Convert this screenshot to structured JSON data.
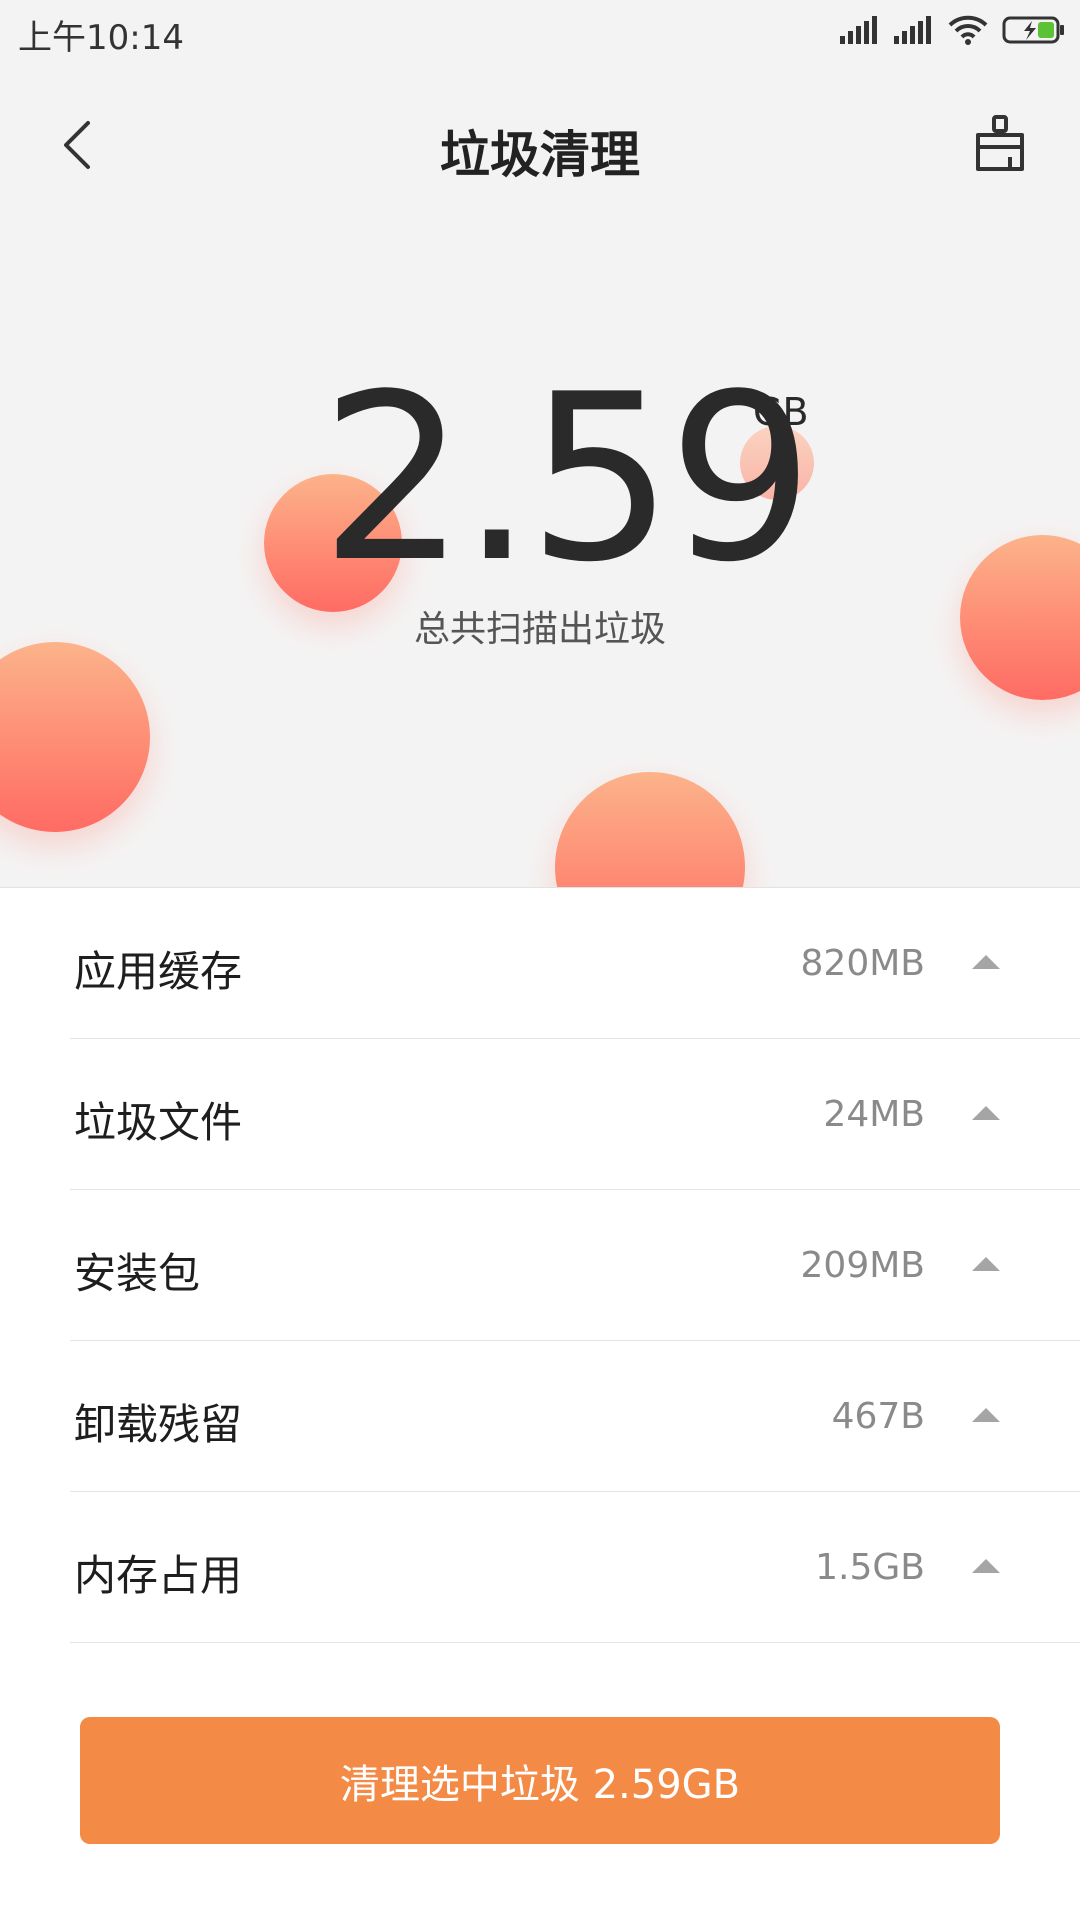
{
  "status_bar": {
    "time": "上午10:14",
    "icons": [
      "signal-icon",
      "signal-icon",
      "wifi-icon",
      "battery-charging-icon"
    ]
  },
  "nav": {
    "title": "垃圾清理",
    "back_icon": "chevron-left-icon",
    "right_icon": "broom-icon"
  },
  "summary": {
    "size_value": "2.59",
    "size_unit": "GB",
    "caption": "总共扫描出垃圾"
  },
  "categories": [
    {
      "label": "应用缓存",
      "size": "820MB"
    },
    {
      "label": "垃圾文件",
      "size": "24MB"
    },
    {
      "label": "安装包",
      "size": "209MB"
    },
    {
      "label": "卸载残留",
      "size": "467B"
    },
    {
      "label": "内存占用",
      "size": "1.5GB"
    }
  ],
  "action": {
    "clean_button_label": "清理选中垃圾 2.59GB"
  },
  "colors": {
    "accent": "#f38a45",
    "bubble_top": "#fcb38a",
    "bubble_bottom": "#ff6b63",
    "background_top": "#f4f3f3"
  }
}
